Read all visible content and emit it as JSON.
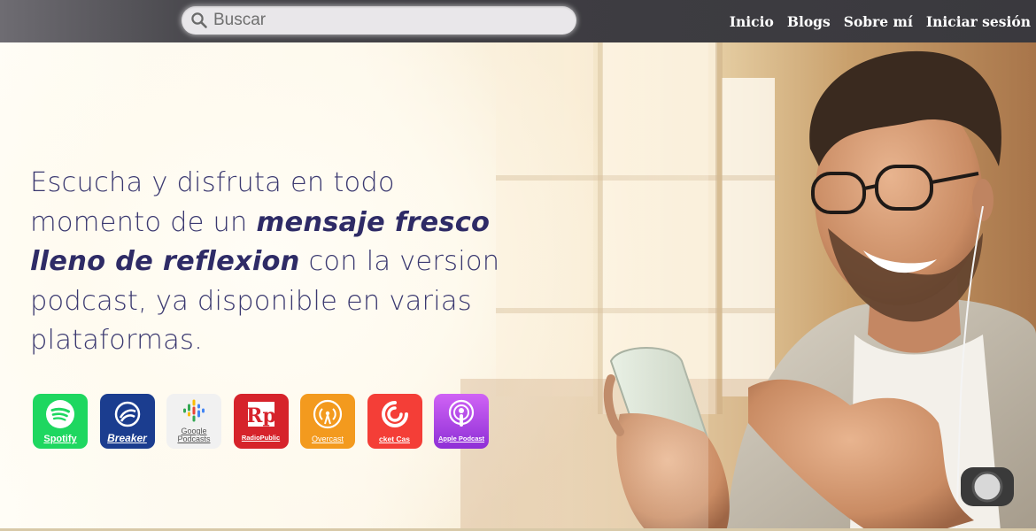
{
  "search": {
    "placeholder": "Buscar"
  },
  "nav": {
    "items": [
      {
        "label": "Inicio"
      },
      {
        "label": "Blogs"
      },
      {
        "label": "Sobre mí"
      },
      {
        "label": "Iniciar sesión"
      }
    ]
  },
  "hero": {
    "text_1": "Escucha y disfruta en todo momento de un ",
    "emphasis": "mensaje fresco lleno de reflexion",
    "text_2": " con la version podcast,  ya disponible en varias plataformas.",
    "image_icon": "man-with-phone-photo"
  },
  "platforms": [
    {
      "label": "Spotify",
      "icon": "spotify-icon"
    },
    {
      "label": "Breaker",
      "icon": "breaker-icon"
    },
    {
      "label": "Google Podcasts",
      "line1": "Google",
      "line2": "Podcasts",
      "icon": "google-podcasts-icon"
    },
    {
      "label": "RadioPublic",
      "icon": "radiopublic-icon"
    },
    {
      "label": "Overcast",
      "icon": "overcast-icon"
    },
    {
      "label": "cket Cas",
      "icon": "pocket-casts-icon"
    },
    {
      "label": "Apple Podcast",
      "icon": "apple-podcasts-icon"
    }
  ],
  "colors": {
    "headline": "#3b3970",
    "topbar": "#3e3d42",
    "spotify": "#1ed760",
    "breaker": "#1b3d8f",
    "radiopublic": "#d6232b",
    "overcast": "#f39a1e",
    "pocketcasts": "#f43e37",
    "apple": "#a447e6"
  }
}
